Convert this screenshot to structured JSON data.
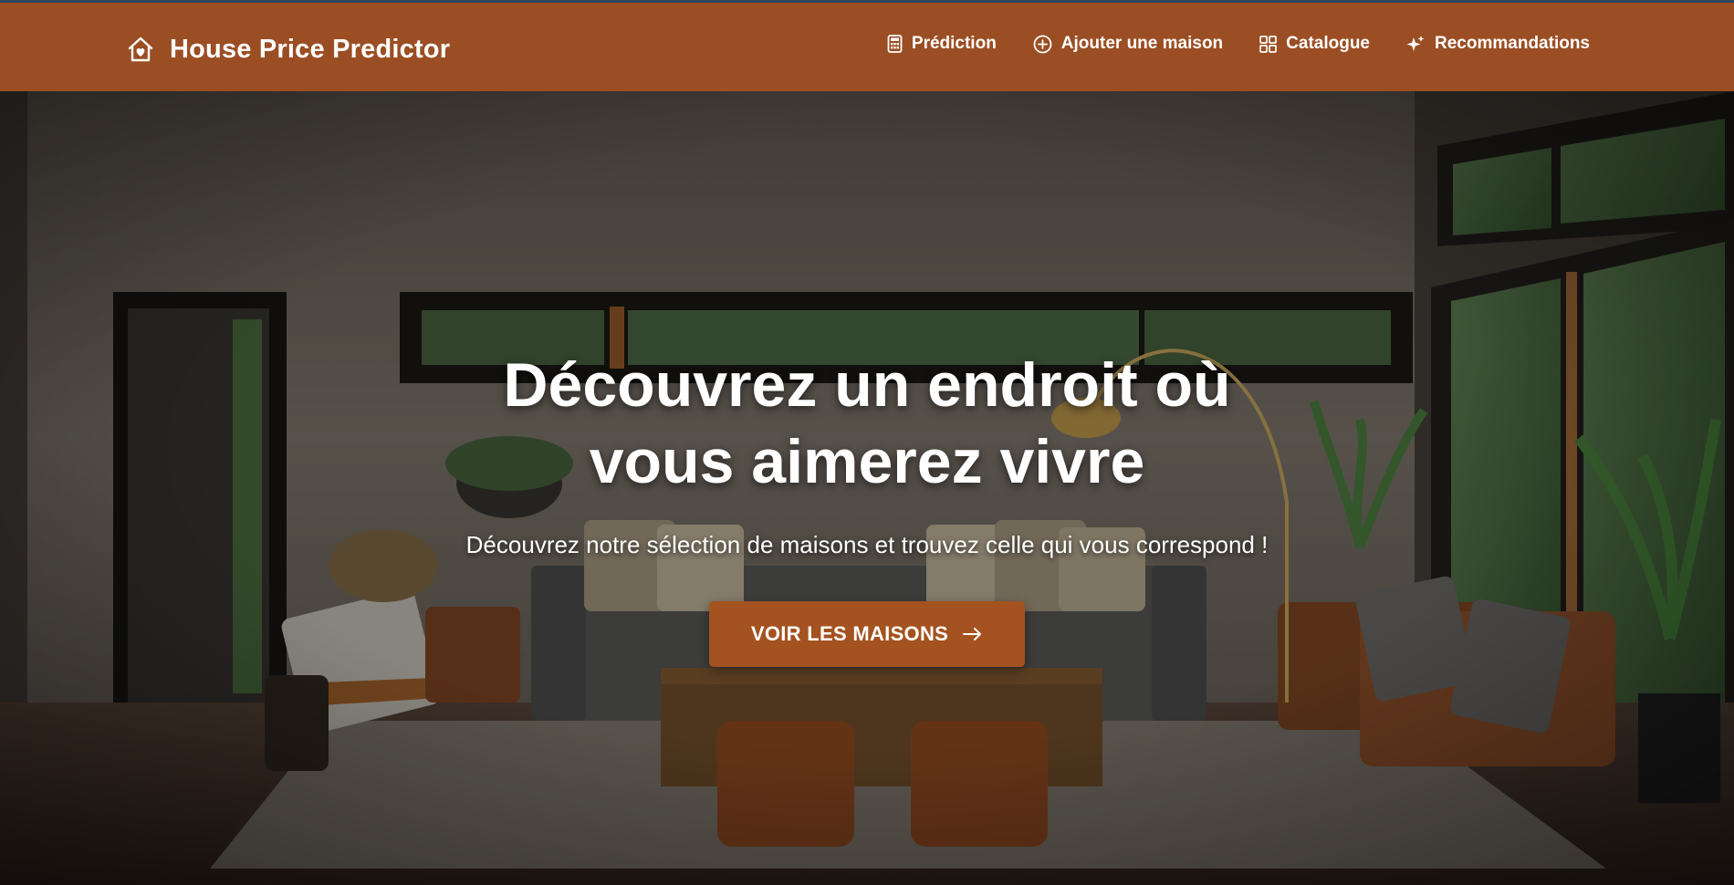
{
  "app": {
    "brand_title": "House Price Predictor",
    "accent_color": "#9b4e23"
  },
  "nav": {
    "items": [
      {
        "label": "Prédiction",
        "icon": "calculator-icon"
      },
      {
        "label": "Ajouter une maison",
        "icon": "plus-circle-icon"
      },
      {
        "label": "Catalogue",
        "icon": "grid-icon"
      },
      {
        "label": "Recommandations",
        "icon": "sparkles-icon"
      }
    ]
  },
  "hero": {
    "title_line1": "Découvrez un endroit où",
    "title_line2": "vous aimerez vivre",
    "subtitle": "Découvrez notre sélection de maisons et trouvez celle qui vous correspond !",
    "cta_label": "VOIR LES MAISONS",
    "cta_icon": "arrow-right-icon",
    "background": "living-room-photo"
  }
}
